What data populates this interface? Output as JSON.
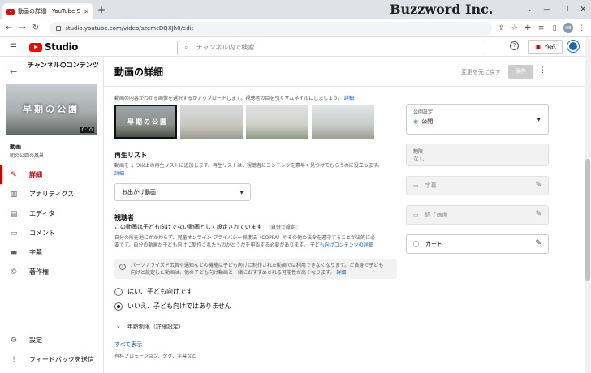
{
  "browser": {
    "tab_title": "動画の詳細 - YouTube Studio",
    "url": "studio.youtube.com/video/szemcDQXJh0/edit",
    "brand": "Buzzword Inc.",
    "avatar_initials": "DB"
  },
  "header": {
    "logo_text": "Studio",
    "search_placeholder": "チャンネル内で検索",
    "create_label": "作成"
  },
  "sidebar": {
    "channel": "チャンネルのコンテンツ",
    "thumb_text": "早期の公園",
    "duration": "0:10",
    "video_label": "動画",
    "video_title": "朝の公園の風景",
    "nav": [
      {
        "label": "詳細",
        "icon": "pencil-icon"
      },
      {
        "label": "アナリティクス",
        "icon": "analytics-icon"
      },
      {
        "label": "エディタ",
        "icon": "editor-icon"
      },
      {
        "label": "コメント",
        "icon": "comment-icon"
      },
      {
        "label": "字幕",
        "icon": "subtitle-icon"
      },
      {
        "label": "著作権",
        "icon": "copyright-icon"
      }
    ],
    "settings": "設定",
    "feedback": "フィードバックを送信"
  },
  "main": {
    "title": "動画の詳細",
    "undo": "変更を元に戻す",
    "save": "保存",
    "thumb_desc": "動画の内容がわかる画像を選択するかアップロードします。視聴者の目を引くサムネイルにしましょう。",
    "thumb_link": "詳細",
    "thumb1_text": "早期の公園",
    "playlist_heading": "再生リスト",
    "playlist_desc": "動画を 1 つ以上の再生リストに追加します。再生リストは、視聴者にコンテンツを素早く見つけてもらうのに役立ちます。",
    "playlist_link": "詳細",
    "playlist_value": "お出かけ動画",
    "audience_heading": "視聴者",
    "audience_status": "この動画は子ども向けでない動画として設定されています",
    "audience_chip": "自分で設定",
    "audience_desc1": "自分の所在地にかかわらず、児童オンライン プライバシー保護法（COPPA）やその他の法令を遵守することが法的に必",
    "audience_desc2": "要です。自分の動画が子ども向けに制作されたものかどうかを申告する必要があります。",
    "audience_link": "子ども向けコンテンツの詳細",
    "info1": "パーソナライズド広告や通知などの機能は子ども向けに制作された動画では利用できなくなります。ご自身で子ども",
    "info2": "向けと設定した動画は、他の子ども向け動画と一緒におすすめされる可能性が高くなります。",
    "info_link": "詳細",
    "radio_yes": "はい、子ども向けです",
    "radio_no": "いいえ、子ども向けではありません",
    "age": "年齢制限（詳細設定）",
    "show_all": "すべて表示",
    "sub": "有料プロモーション、タグ、字幕など"
  },
  "right": {
    "vis_label": "公開設定",
    "vis_value": "公開",
    "restrict_label": "制限",
    "restrict_value": "なし",
    "subtitles": "字幕",
    "endscreen": "終了画面",
    "cards": "カード"
  },
  "colors": {
    "accent": "#cc0000",
    "link": "#065fd4"
  }
}
